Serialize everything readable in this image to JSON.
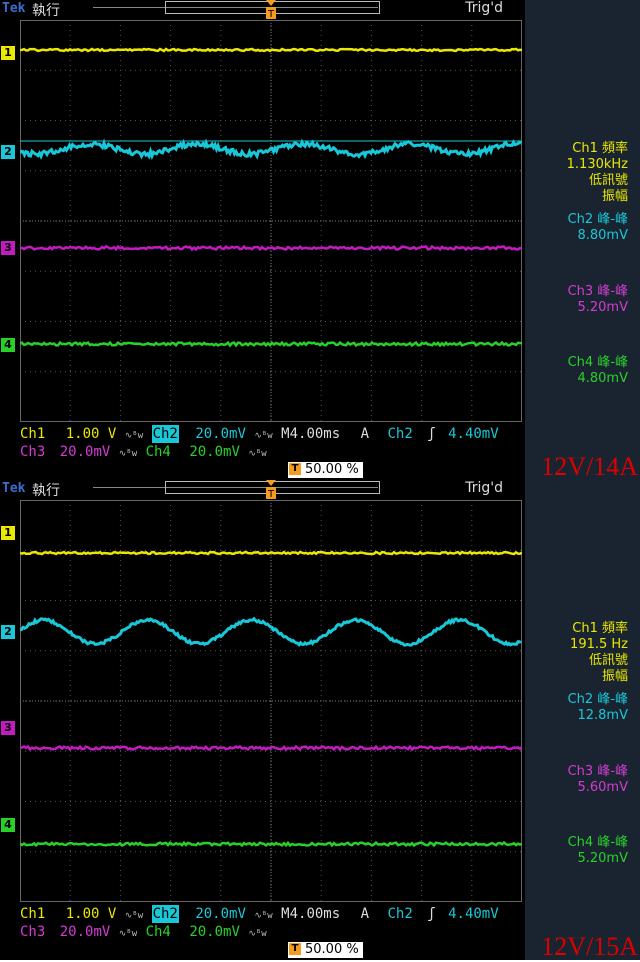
{
  "screens": [
    {
      "brand": "Tek",
      "mode": "執行",
      "trigger_status": "Trig'd",
      "trigger_marker": "T",
      "channel_markers": [
        "1",
        "2",
        "3",
        "4"
      ],
      "row1": {
        "ch1": "Ch1",
        "ch1_scale": "1.00 V",
        "ch2": "Ch2",
        "ch2_scale": "20.0mV",
        "timebase": "M4.00ms",
        "trig_src_prefix": "A",
        "trig_src": "Ch2",
        "trig_slope": "ʃ",
        "trig_level": "4.40mV"
      },
      "row2": {
        "ch3": "Ch3",
        "ch3_scale": "20.0mV",
        "ch4": "Ch4",
        "ch4_scale": "20.0mV"
      },
      "trigger_position": "50.00 %",
      "measurements": {
        "ch1": {
          "title": "Ch1 頻率",
          "value": "1.130kHz",
          "note1": "低訊號",
          "note2": "振幅"
        },
        "ch2": {
          "title": "Ch2 峰-峰",
          "value": "8.80mV"
        },
        "ch3": {
          "title": "Ch3 峰-峰",
          "value": "5.20mV"
        },
        "ch4": {
          "title": "Ch4 峰-峰",
          "value": "4.80mV"
        }
      },
      "caption": "12V/14A",
      "colors": {
        "ch1": "#e8e800",
        "ch2": "#19c8d8",
        "ch3": "#c21bc2",
        "ch4": "#2ad02a",
        "caption": "#dd0000"
      }
    },
    {
      "brand": "Tek",
      "mode": "執行",
      "trigger_status": "Trig'd",
      "trigger_marker": "T",
      "channel_markers": [
        "1",
        "2",
        "3",
        "4"
      ],
      "row1": {
        "ch1": "Ch1",
        "ch1_scale": "1.00 V",
        "ch2": "Ch2",
        "ch2_scale": "20.0mV",
        "timebase": "M4.00ms",
        "trig_src_prefix": "A",
        "trig_src": "Ch2",
        "trig_slope": "ʃ",
        "trig_level": "4.40mV"
      },
      "row2": {
        "ch3": "Ch3",
        "ch3_scale": "20.0mV",
        "ch4": "Ch4",
        "ch4_scale": "20.0mV"
      },
      "trigger_position": "50.00 %",
      "measurements": {
        "ch1": {
          "title": "Ch1 頻率",
          "value": "191.5 Hz",
          "note1": "低訊號",
          "note2": "振幅"
        },
        "ch2": {
          "title": "Ch2 峰-峰",
          "value": "12.8mV"
        },
        "ch3": {
          "title": "Ch3 峰-峰",
          "value": "5.60mV"
        },
        "ch4": {
          "title": "Ch4 峰-峰",
          "value": "5.20mV"
        }
      },
      "caption": "12V/15A",
      "colors": {
        "ch1": "#e8e800",
        "ch2": "#19c8d8",
        "ch3": "#c21bc2",
        "ch4": "#2ad02a",
        "caption": "#dd0000"
      }
    }
  ]
}
